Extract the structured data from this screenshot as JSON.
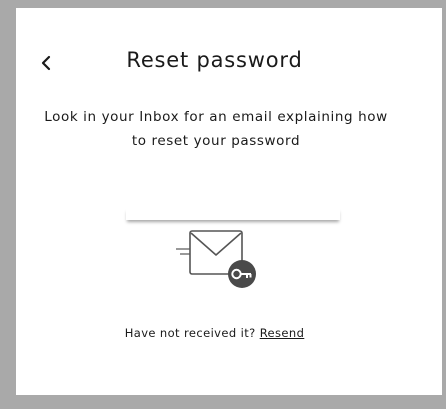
{
  "header": {
    "title": "Reset password",
    "back_icon": "chevron-left-icon"
  },
  "body": {
    "message": "Look in your Inbox for an email explaining how to reset your password"
  },
  "illustration": {
    "icon": "email-key-icon"
  },
  "footer": {
    "prompt": "Have not received it?",
    "resend_label": "Resend"
  },
  "colors": {
    "background_overlay": "#a9a9a9",
    "card": "#ffffff",
    "text": "#1a1a1a",
    "key_badge": "#4a4a4a"
  }
}
